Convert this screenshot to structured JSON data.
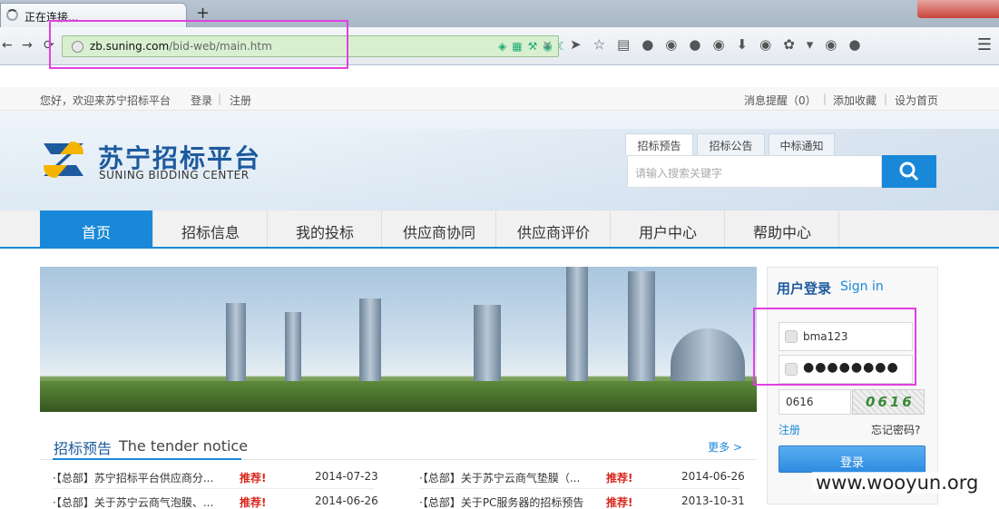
{
  "browser": {
    "tab_title": "正在连接...",
    "new_tab": "+",
    "url_domain": "zb.suning.com",
    "url_path": "/bid-web/main.htm",
    "menu_icon": "menu-icon"
  },
  "topbar": {
    "welcome": "您好，欢迎来苏宁招标平台",
    "login": "登录",
    "register": "注册",
    "messages": "消息提醒（0）",
    "favorite": "添加收藏",
    "homepage": "设为首页"
  },
  "header": {
    "logo_cn": "苏宁招标平台",
    "logo_en": "SUNING BIDDING CENTER",
    "search_tabs": [
      "招标预告",
      "招标公告",
      "中标通知"
    ],
    "search_placeholder": "请输入搜索关键字"
  },
  "nav": [
    "首页",
    "招标信息",
    "我的投标",
    "供应商协同",
    "供应商评价",
    "用户中心",
    "帮助中心"
  ],
  "news": {
    "title_cn": "招标预告",
    "title_en": "The tender notice",
    "more": "更多 >",
    "items": [
      {
        "title": "·【总部】苏宁招标平台供应商分...",
        "tag": "推荐!",
        "date": "2014-07-23"
      },
      {
        "title": "·【总部】关于苏宁云商气垫膜（...",
        "tag": "推荐!",
        "date": "2014-06-26"
      },
      {
        "title": "·【总部】关于苏宁云商气泡膜、...",
        "tag": "推荐!",
        "date": "2014-06-26"
      },
      {
        "title": "·【总部】关于PC服务器的招标预告",
        "tag": "推荐!",
        "date": "2013-10-31"
      }
    ]
  },
  "login": {
    "title_cn": "用户登录",
    "title_en": "Sign in",
    "username": "bma123",
    "password": "●●●●●●●●",
    "captcha_value": "0616",
    "captcha_image_text": "0616",
    "register": "注册",
    "forgot": "忘记密码?",
    "submit": "登录"
  },
  "watermark": "www.wooyun.org",
  "colors": {
    "accent": "#1a88d8",
    "brand": "#1d5a9e",
    "highlight": "#e040e0",
    "hot": "#d8261c"
  }
}
